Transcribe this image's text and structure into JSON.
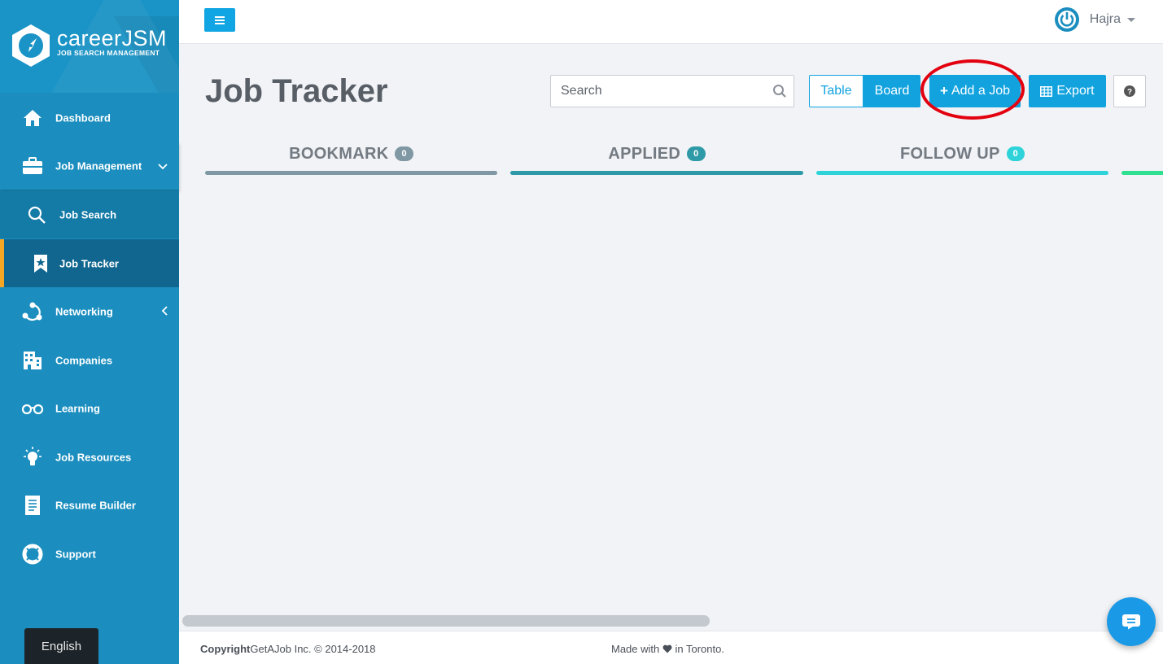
{
  "brand": {
    "name": "careerJSM",
    "tagline": "JOB SEARCH MANAGEMENT"
  },
  "sidebar": {
    "items": [
      {
        "label": "Dashboard",
        "icon": "home-icon"
      },
      {
        "label": "Job Management",
        "icon": "briefcase-icon"
      },
      {
        "label": "Job Search",
        "icon": "search-icon"
      },
      {
        "label": "Job Tracker",
        "icon": "bookmark-star-icon"
      },
      {
        "label": "Networking",
        "icon": "network-icon"
      },
      {
        "label": "Companies",
        "icon": "building-icon"
      },
      {
        "label": "Learning",
        "icon": "glasses-icon"
      },
      {
        "label": "Job Resources",
        "icon": "lightbulb-icon"
      },
      {
        "label": "Resume Builder",
        "icon": "document-icon"
      },
      {
        "label": "Support",
        "icon": "lifebuoy-icon"
      }
    ],
    "language": "English"
  },
  "topbar": {
    "user_name": "Hajra"
  },
  "main": {
    "title": "Job Tracker",
    "search_placeholder": "Search",
    "view_table": "Table",
    "view_board": "Board",
    "add_job": "Add a Job",
    "export": "Export",
    "columns": [
      {
        "title": "BOOKMARK",
        "count": "0",
        "color": "#7f98a4"
      },
      {
        "title": "APPLIED",
        "count": "0",
        "color": "#2e9aa7"
      },
      {
        "title": "FOLLOW UP",
        "count": "0",
        "color": "#2ed3d9"
      }
    ],
    "next_column_color": "#2ee08f"
  },
  "footer": {
    "copyright_bold": "Copyright",
    "copyright_rest": "GetAJob Inc. © 2014-2018",
    "made_with": "Made with",
    "made_in": "in Toronto."
  },
  "colors": {
    "accent": "#12a3df",
    "sidebar": "#1b8ebf",
    "active_marker": "#f5a623",
    "annotation": "#e3000f"
  }
}
